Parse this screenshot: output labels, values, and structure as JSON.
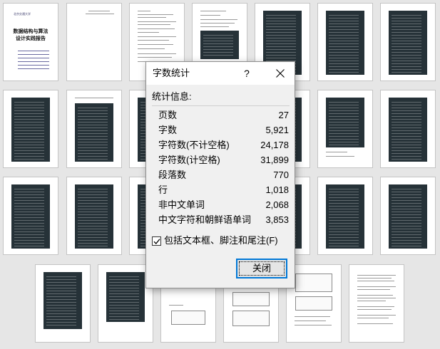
{
  "cover": {
    "title_line1": "数据结构与算法",
    "title_line2": "设计实践报告",
    "logo_text": "北京交通大学"
  },
  "dialog": {
    "title": "字数统计",
    "help_glyph": "?",
    "section_label": "统计信息:",
    "stats": [
      {
        "label": "页数",
        "value": "27"
      },
      {
        "label": "字数",
        "value": "5,921"
      },
      {
        "label": "字符数(不计空格)",
        "value": "24,178"
      },
      {
        "label": "字符数(计空格)",
        "value": "31,899"
      },
      {
        "label": "段落数",
        "value": "770"
      },
      {
        "label": "行",
        "value": "1,018"
      },
      {
        "label": "非中文单词",
        "value": "2,068"
      },
      {
        "label": "中文字符和朝鲜语单词",
        "value": "3,853"
      }
    ],
    "checkbox": {
      "label": "包括文本框、脚注和尾注(F)",
      "checked": true
    },
    "close_button_label": "关闭"
  },
  "colors": {
    "accent": "#0078d7",
    "code_bg": "#263238",
    "dialog_bg": "#f0f0f0",
    "desktop_bg": "#e6e6e6"
  },
  "icons": [
    "help-icon",
    "close-icon",
    "checkmark-icon"
  ]
}
